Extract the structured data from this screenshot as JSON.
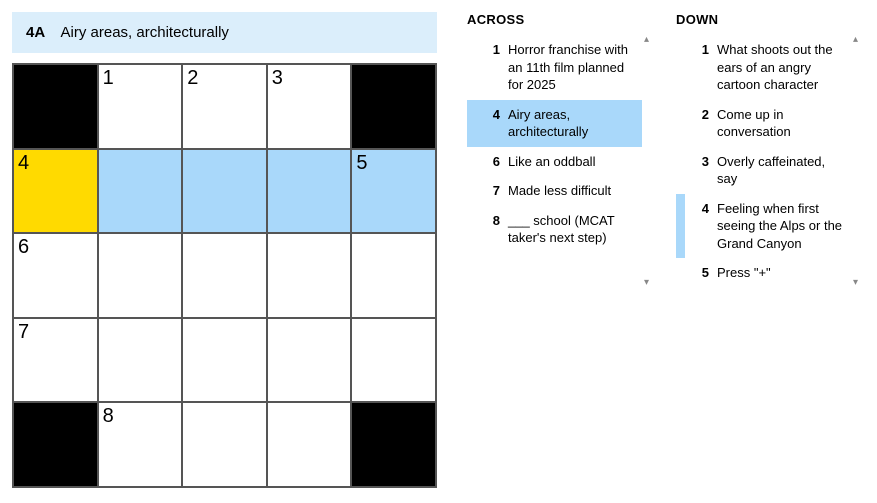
{
  "clueBar": {
    "id": "4A",
    "text": "Airy areas, architecturally"
  },
  "grid": {
    "rows": 5,
    "cols": 5,
    "cells": [
      [
        {
          "black": true
        },
        {
          "num": "1"
        },
        {
          "num": "2"
        },
        {
          "num": "3"
        },
        {
          "black": true
        }
      ],
      [
        {
          "num": "4",
          "cursor": true
        },
        {
          "hl": true
        },
        {
          "hl": true
        },
        {
          "hl": true
        },
        {
          "num": "5",
          "hl": true
        }
      ],
      [
        {
          "num": "6"
        },
        {},
        {},
        {},
        {}
      ],
      [
        {
          "num": "7"
        },
        {},
        {},
        {},
        {}
      ],
      [
        {
          "black": true
        },
        {
          "num": "8"
        },
        {},
        {},
        {
          "black": true
        }
      ]
    ]
  },
  "across": {
    "title": "ACROSS",
    "clues": [
      {
        "num": "1",
        "text": "Horror franchise with an 11th film planned for 2025"
      },
      {
        "num": "4",
        "text": "Airy areas, architecturally",
        "selected": true
      },
      {
        "num": "6",
        "text": "Like an oddball"
      },
      {
        "num": "7",
        "text": "Made less difficult"
      },
      {
        "num": "8",
        "text": "___ school (MCAT taker's next step)"
      }
    ]
  },
  "down": {
    "title": "DOWN",
    "clues": [
      {
        "num": "1",
        "text": "What shoots out the ears of an angry cartoon character"
      },
      {
        "num": "2",
        "text": "Come up in conversation"
      },
      {
        "num": "3",
        "text": "Overly caffeinated, say"
      },
      {
        "num": "4",
        "text": "Feeling when first seeing the Alps or the Grand Canyon",
        "related": true
      },
      {
        "num": "5",
        "text": "Press \"+\""
      }
    ]
  }
}
